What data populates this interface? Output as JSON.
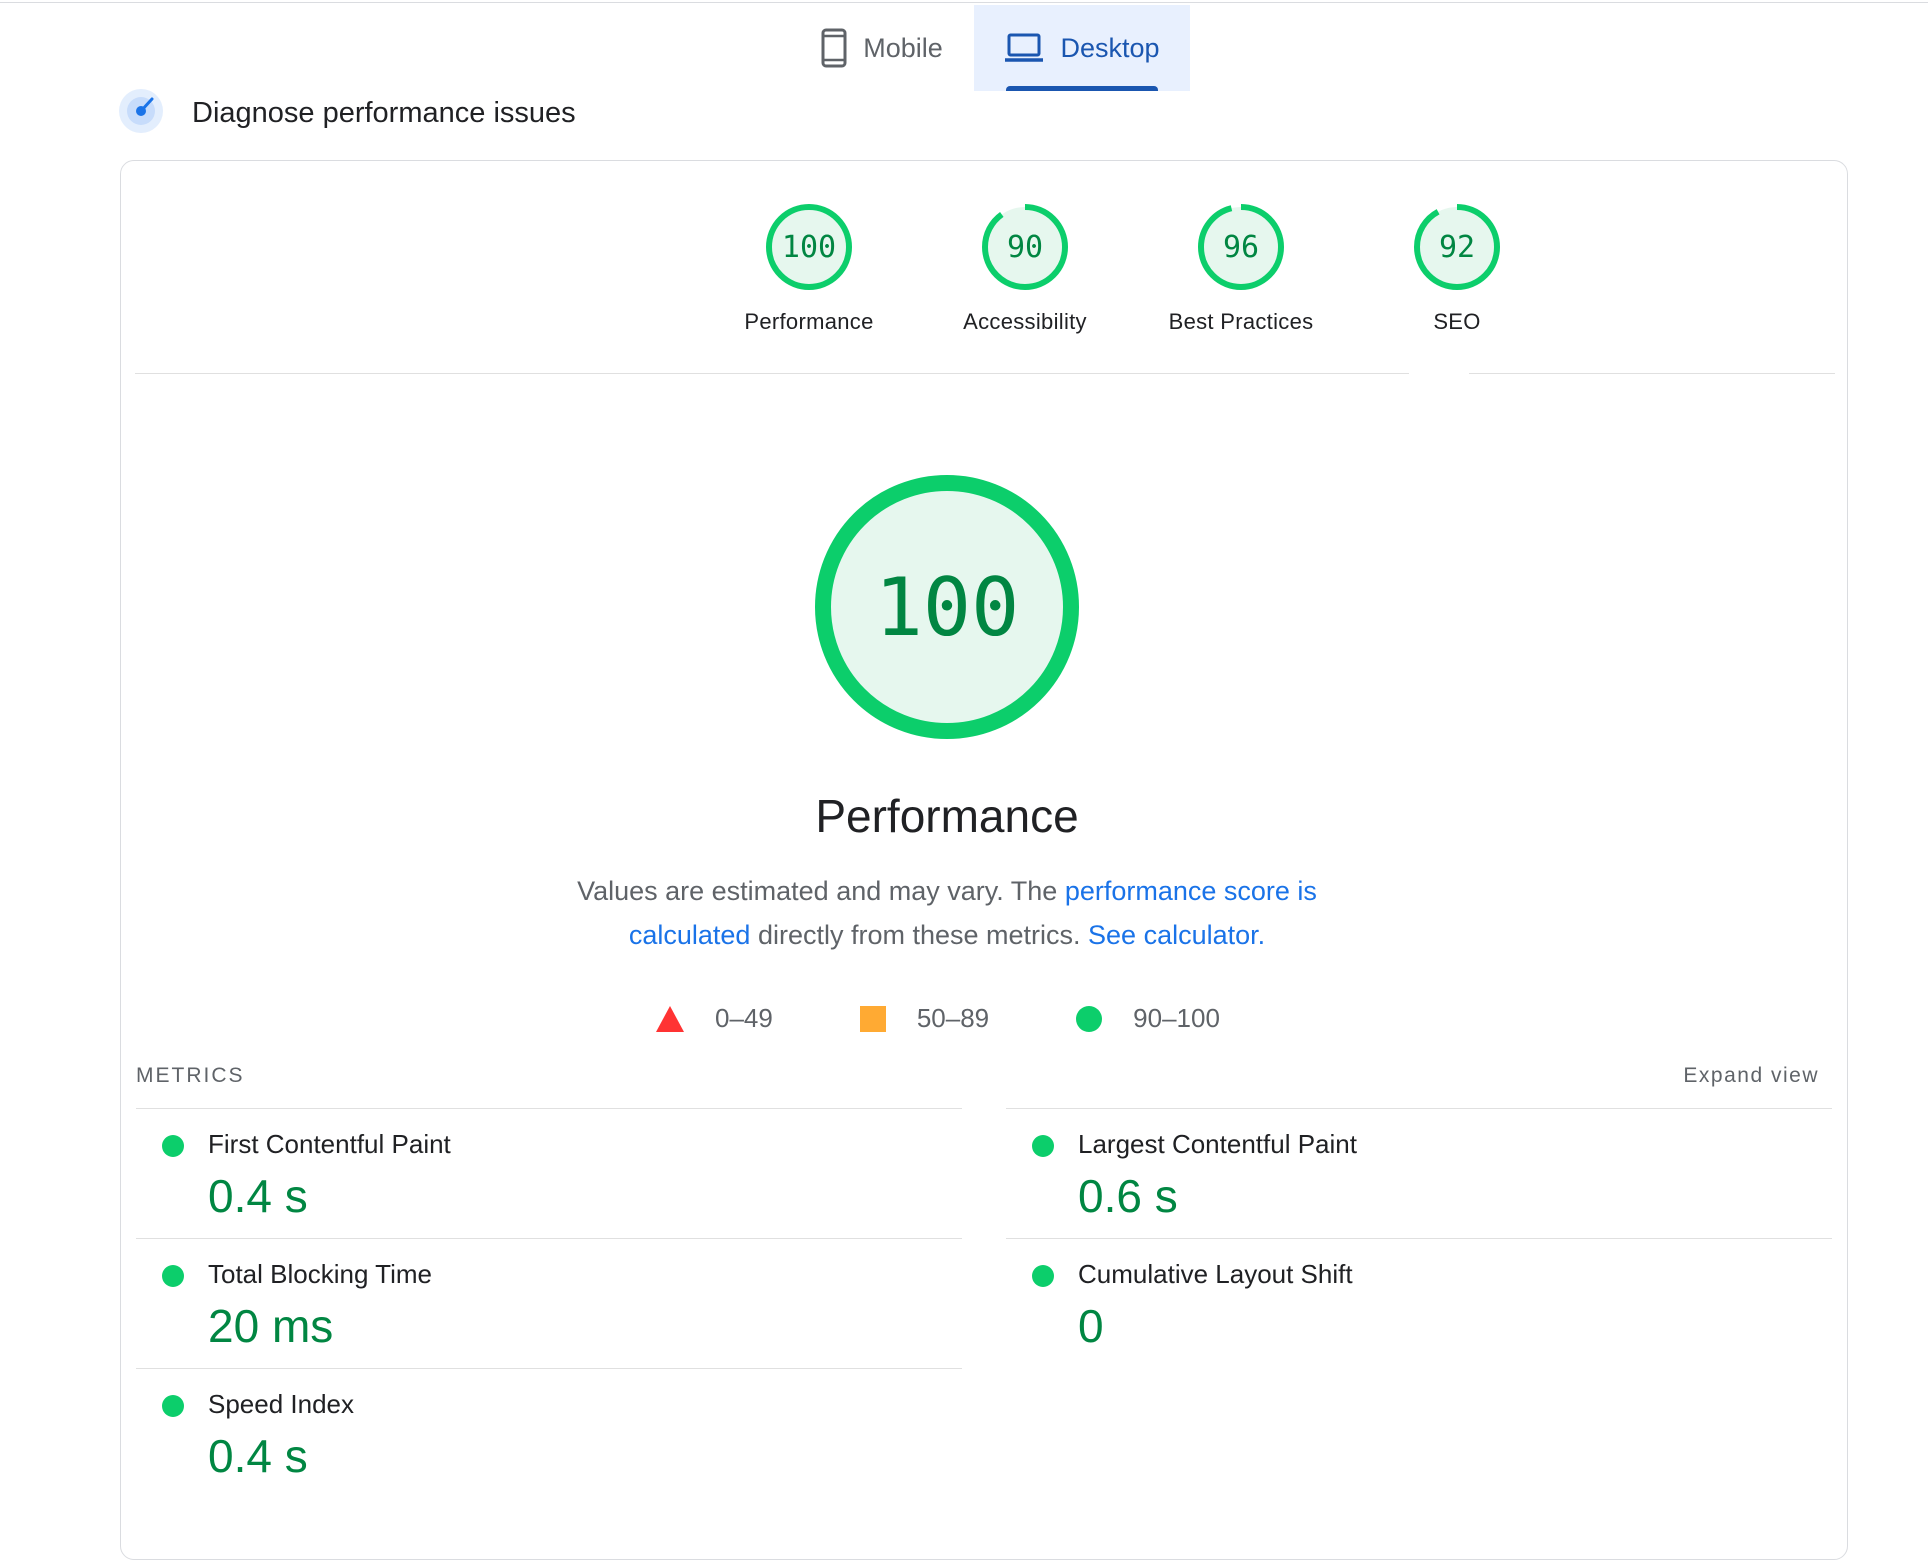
{
  "tabs": [
    {
      "label": "Mobile",
      "icon": "phone-icon",
      "active": false
    },
    {
      "label": "Desktop",
      "icon": "laptop-icon",
      "active": true
    }
  ],
  "header": {
    "title": "Diagnose performance issues",
    "icon": "lighthouse-gauge-icon"
  },
  "categories": [
    {
      "label": "Performance",
      "score": "100"
    },
    {
      "label": "Accessibility",
      "score": "90"
    },
    {
      "label": "Best Practices",
      "score": "96"
    },
    {
      "label": "SEO",
      "score": "92"
    }
  ],
  "main": {
    "score": "100",
    "title": "Performance",
    "desc_prefix": "Values are estimated and may vary. The ",
    "desc_link1": "performance score is calculated",
    "desc_middle": " directly from these metrics. ",
    "desc_link2": "See calculator.",
    "legend": [
      {
        "shape": "triangle",
        "color": "#ff3333",
        "label": "0–49"
      },
      {
        "shape": "square",
        "color": "#ffaa33",
        "label": "50–89"
      },
      {
        "shape": "circle",
        "color": "#0cce6b",
        "label": "90–100"
      }
    ]
  },
  "metrics": {
    "label": "METRICS",
    "expand": "Expand view",
    "items": [
      {
        "name": "First Contentful Paint",
        "value": "0.4 s"
      },
      {
        "name": "Largest Contentful Paint",
        "value": "0.6 s"
      },
      {
        "name": "Total Blocking Time",
        "value": "20 ms"
      },
      {
        "name": "Cumulative Layout Shift",
        "value": "0"
      },
      {
        "name": "Speed Index",
        "value": "0.4 s"
      }
    ]
  },
  "colors": {
    "pass": "#0cce6b",
    "pass_fill": "#e6f7ee",
    "pass_text": "#018642",
    "accent": "#1a56b0",
    "link": "#1a73e8"
  }
}
